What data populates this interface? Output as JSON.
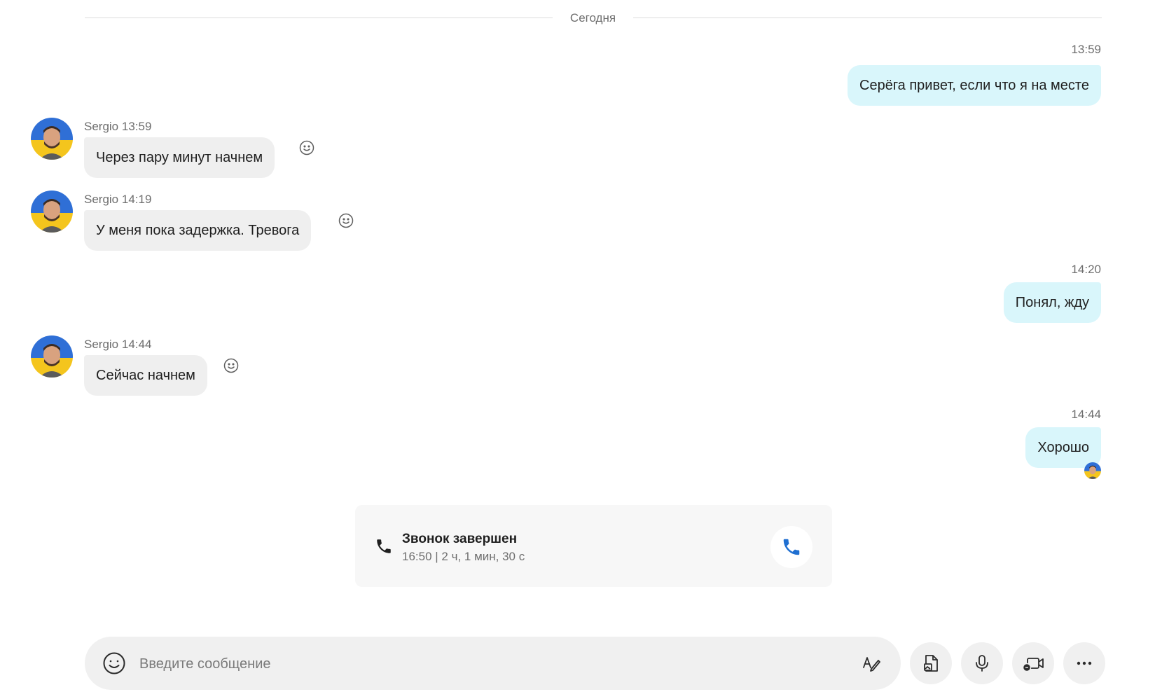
{
  "divider": {
    "label": "Сегодня"
  },
  "outgoing": [
    {
      "time": "13:59",
      "text": "Серёга привет, если что я на месте"
    },
    {
      "time": "14:20",
      "text": "Понял, жду"
    },
    {
      "time": "14:44",
      "text": "Хорошо"
    }
  ],
  "incoming": [
    {
      "meta": "Sergio 13:59",
      "text": "Через пару минут начнем"
    },
    {
      "meta": "Sergio 14:19",
      "text": "У меня пока задержка. Тревога"
    },
    {
      "meta": "Sergio 14:44",
      "text": "Сейчас начнем"
    }
  ],
  "call": {
    "title": "Звонок завершен",
    "details": "16:50 | 2 ч, 1 мин, 30 с"
  },
  "composer": {
    "placeholder": "Введите сообщение"
  },
  "icons": {
    "reaction": "smiley-icon",
    "phone": "phone-icon",
    "call_back": "phone-icon",
    "emoji": "smiley-icon",
    "format": "text-format-icon",
    "file": "file-image-icon",
    "mic": "microphone-icon",
    "video_message": "video-message-icon",
    "more": "more-icon"
  },
  "colors": {
    "outgoing_bubble": "#d9f6fb",
    "incoming_bubble": "#efefef",
    "call_accent": "#1f6fd1"
  }
}
